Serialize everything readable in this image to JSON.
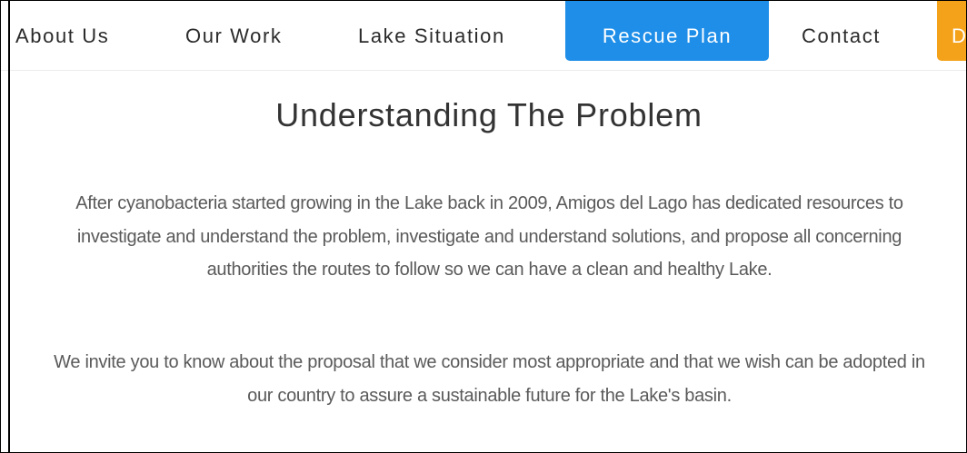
{
  "nav": {
    "items": [
      {
        "label": "About Us"
      },
      {
        "label": "Our Work"
      },
      {
        "label": "Lake Situation"
      },
      {
        "label": "Rescue Plan",
        "active": true
      },
      {
        "label": "Contact"
      },
      {
        "label": "D"
      }
    ],
    "active_color": "#1e8ee8",
    "donate_color": "#f3a21a"
  },
  "main": {
    "title": "Understanding The Problem",
    "paragraphs": [
      "After cyanobacteria started growing in the Lake back in 2009, Amigos del Lago has dedicated resources to investigate and understand the problem, investigate and understand solutions, and propose all concerning authorities the routes to follow so we can have a clean and healthy Lake.",
      "We invite you to know about the proposal that we consider most appropriate and that we wish can be adopted in our country to assure a sustainable future for the Lake's basin."
    ]
  }
}
